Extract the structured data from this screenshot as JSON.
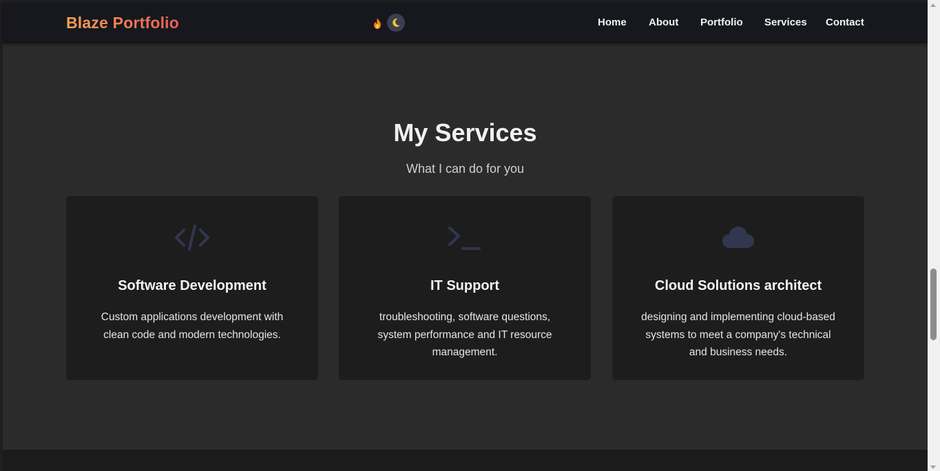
{
  "colors": {
    "page_background": "#2b2b2b",
    "navbar_background": "#16181d",
    "card_background": "#1d1d1d",
    "brand_gradient": [
      "#f5a05a",
      "#ee5c55"
    ],
    "icon_color": "#32364f",
    "footer_background": "#1b1b1b"
  },
  "navbar": {
    "brand": "Blaze Portfolio",
    "theme_toggle": {
      "light_icon": "flame-icon",
      "dark_icon": "moon-icon",
      "active": "dark"
    },
    "links": [
      "Home",
      "About",
      "Portfolio",
      "Services",
      "Contact"
    ]
  },
  "services": {
    "title": "My Services",
    "subtitle": "What I can do for you",
    "cards": [
      {
        "icon": "code-icon",
        "title": "Software Development",
        "description": "Custom applications development with clean code and modern technologies."
      },
      {
        "icon": "terminal-icon",
        "title": "IT Support",
        "description": "troubleshooting, software questions, system performance and IT resource management."
      },
      {
        "icon": "cloud-icon",
        "title": "Cloud Solutions architect",
        "description": "designing and implementing cloud-based systems to meet a company's technical and business needs."
      }
    ]
  }
}
